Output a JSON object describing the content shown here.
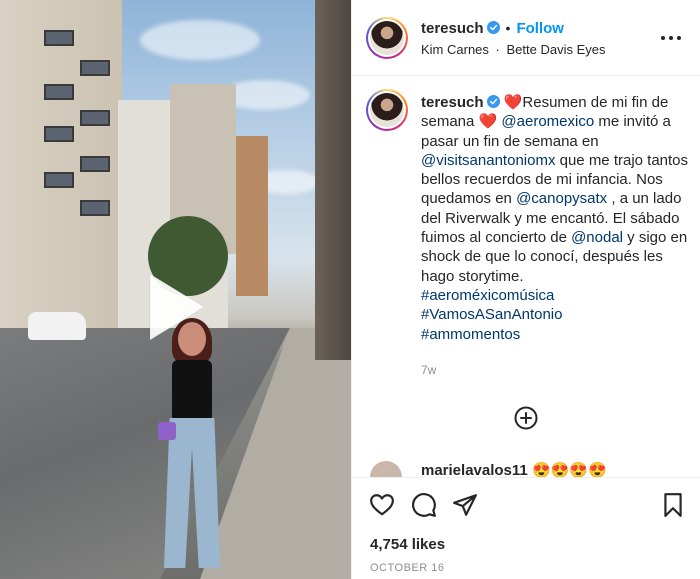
{
  "post": {
    "username": "teresuch",
    "separator": "•",
    "follow_label": "Follow",
    "music": {
      "artist": "Kim Carnes",
      "separator": "·",
      "song": "Bette Davis Eyes"
    },
    "caption": {
      "username": "teresuch",
      "heart_left": "❤️",
      "part1": "Resumen de mi fin de semana ",
      "heart_right": "❤️",
      "mention1": "@aeromexico",
      "part2": " me invitó a pasar un fin de semana en ",
      "mention2": "@visitsanantoniomx",
      "part3": " que me trajo tantos bellos recuerdos de mi infancia. Nos quedamos en ",
      "mention3": "@canopysatx",
      "part4": " , a un lado del Riverwalk y me encantó. El sábado fuimos al concierto de ",
      "mention4": "@nodal",
      "part5": " y sigo en shock de que lo conocí, después les hago storytime.",
      "hashtags": [
        "#aeroméxicomúsica",
        "#VamosASanAntonio",
        "#ammomentos"
      ]
    },
    "time_ago": "7w",
    "next_comment": {
      "username": "marielavalos11",
      "text": "😍😍😍😍"
    },
    "likes": "4,754 likes",
    "date": "OCTOBER 16"
  },
  "colors": {
    "link": "#00376b",
    "follow": "#0095f6",
    "muted": "#8e8e8e",
    "text": "#262626",
    "verified": "#3897f0"
  },
  "icons": {
    "verified": "verified-badge-icon",
    "more": "more-options-icon",
    "play": "play-icon",
    "load_more": "plus-circle-icon",
    "like": "heart-icon",
    "comment": "comment-bubble-icon",
    "share": "paper-plane-icon",
    "save": "bookmark-icon"
  }
}
